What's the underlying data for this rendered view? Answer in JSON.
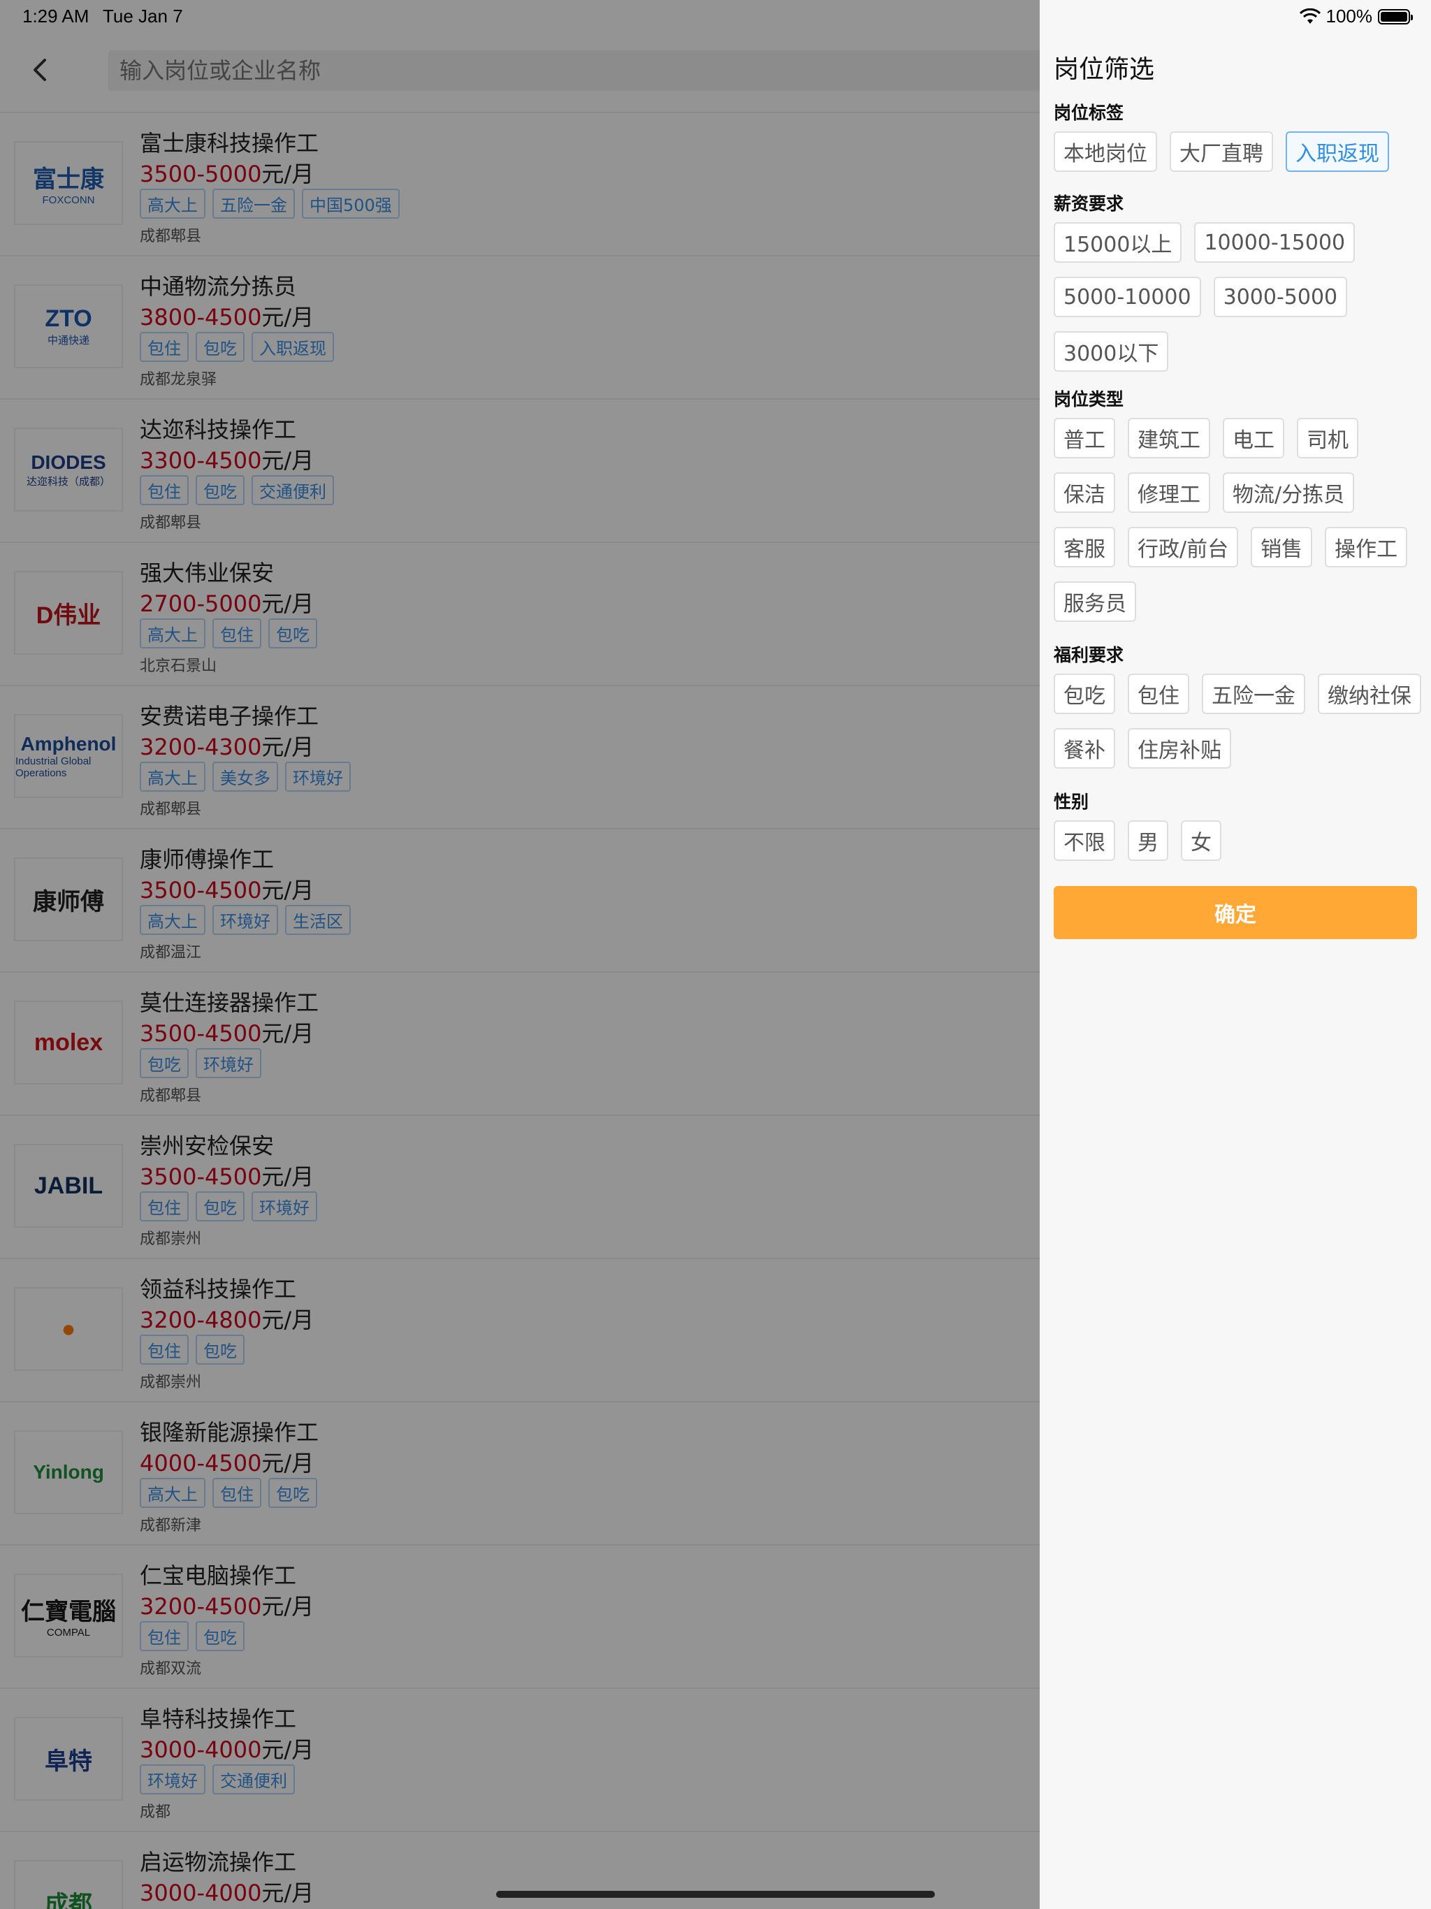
{
  "status_bar": {
    "time": "1:29 AM",
    "date": "Tue Jan 7",
    "battery": "100%"
  },
  "search": {
    "placeholder": "输入岗位或企业名称"
  },
  "jobs": [
    {
      "title": "富士康科技操作工",
      "salary_low": "3500",
      "salary_high": "5000",
      "unit": "元/月",
      "tags": [
        "高大上",
        "五险一金",
        "中国500强"
      ],
      "location": "成都郫县",
      "logo_text": "富士康",
      "logo_sub": "FOXCONN",
      "logo_color": "#1f5fb0"
    },
    {
      "title": "中通物流分拣员",
      "salary_low": "3800",
      "salary_high": "4500",
      "unit": "元/月",
      "tags": [
        "包住",
        "包吃",
        "入职返现"
      ],
      "location": "成都龙泉驿",
      "logo_text": "ZTO",
      "logo_sub": "中通快递",
      "logo_color": "#1c55b0"
    },
    {
      "title": "达迩科技操作工",
      "salary_low": "3300",
      "salary_high": "4500",
      "unit": "元/月",
      "tags": [
        "包住",
        "包吃",
        "交通便利"
      ],
      "location": "成都郫县",
      "logo_text": "DIODES",
      "logo_sub": "达迩科技（成都）",
      "logo_color": "#1d3e8a"
    },
    {
      "title": "强大伟业保安",
      "salary_low": "2700",
      "salary_high": "5000",
      "unit": "元/月",
      "tags": [
        "高大上",
        "包住",
        "包吃"
      ],
      "location": "北京石景山",
      "logo_text": "D伟业",
      "logo_sub": "",
      "logo_color": "#c0141a"
    },
    {
      "title": "安费诺电子操作工",
      "salary_low": "3200",
      "salary_high": "4300",
      "unit": "元/月",
      "tags": [
        "高大上",
        "美女多",
        "环境好"
      ],
      "location": "成都郫县",
      "logo_text": "Amphenol",
      "logo_sub": "Industrial Global Operations",
      "logo_color": "#1a4d9c"
    },
    {
      "title": "康师傅操作工",
      "salary_low": "3500",
      "salary_high": "4500",
      "unit": "元/月",
      "tags": [
        "高大上",
        "环境好",
        "生活区"
      ],
      "location": "成都温江",
      "logo_text": "康师傅",
      "logo_sub": "",
      "logo_color": "#222222"
    },
    {
      "title": "莫仕连接器操作工",
      "salary_low": "3500",
      "salary_high": "4500",
      "unit": "元/月",
      "tags": [
        "包吃",
        "环境好"
      ],
      "location": "成都郫县",
      "logo_text": "molex",
      "logo_sub": "",
      "logo_color": "#d0141a"
    },
    {
      "title": "崇州安检保安",
      "salary_low": "3500",
      "salary_high": "4500",
      "unit": "元/月",
      "tags": [
        "包住",
        "包吃",
        "环境好"
      ],
      "location": "成都崇州",
      "logo_text": "JABIL",
      "logo_sub": "",
      "logo_color": "#12315e"
    },
    {
      "title": "领益科技操作工",
      "salary_low": "3200",
      "salary_high": "4800",
      "unit": "元/月",
      "tags": [
        "包住",
        "包吃"
      ],
      "location": "成都崇州",
      "logo_text": "●",
      "logo_sub": "",
      "logo_color": "#ff7a00"
    },
    {
      "title": "银隆新能源操作工",
      "salary_low": "4000",
      "salary_high": "4500",
      "unit": "元/月",
      "tags": [
        "高大上",
        "包住",
        "包吃"
      ],
      "location": "成都新津",
      "logo_text": "Yinlong",
      "logo_sub": "",
      "logo_color": "#1c8f3a"
    },
    {
      "title": "仁宝电脑操作工",
      "salary_low": "3200",
      "salary_high": "4500",
      "unit": "元/月",
      "tags": [
        "包住",
        "包吃"
      ],
      "location": "成都双流",
      "logo_text": "仁寶電腦",
      "logo_sub": "COMPAL",
      "logo_color": "#1a1a1a"
    },
    {
      "title": "阜特科技操作工",
      "salary_low": "3000",
      "salary_high": "4000",
      "unit": "元/月",
      "tags": [
        "环境好",
        "交通便利"
      ],
      "location": "成都",
      "logo_text": "阜特",
      "logo_sub": "",
      "logo_color": "#1a3f90"
    },
    {
      "title": "启运物流操作工",
      "salary_low": "3000",
      "salary_high": "4000",
      "unit": "元/月",
      "tags": [],
      "location": "",
      "logo_text": "成都",
      "logo_sub": "",
      "logo_color": "#1c8f3a"
    }
  ],
  "filter": {
    "title": "岗位筛选",
    "sections": [
      {
        "label": "岗位标签",
        "options": [
          "本地岗位",
          "大厂直聘",
          "入职返现"
        ],
        "selected": [
          "入职返现"
        ]
      },
      {
        "label": "薪资要求",
        "options": [
          "15000以上",
          "10000-15000",
          "5000-10000",
          "3000-5000",
          "3000以下"
        ],
        "selected": []
      },
      {
        "label": "岗位类型",
        "options": [
          "普工",
          "建筑工",
          "电工",
          "司机",
          "保洁",
          "修理工",
          "物流/分拣员",
          "客服",
          "行政/前台",
          "销售",
          "操作工",
          "服务员"
        ],
        "selected": []
      },
      {
        "label": "福利要求",
        "options": [
          "包吃",
          "包住",
          "五险一金",
          "缴纳社保",
          "餐补",
          "住房补贴"
        ],
        "selected": []
      },
      {
        "label": "性别",
        "options": [
          "不限",
          "男",
          "女"
        ],
        "selected": []
      }
    ],
    "confirm_label": "确定"
  },
  "colors": {
    "accent": "#ffa836",
    "salary": "#d0021b",
    "tag": "#3a8ee6",
    "selected_chip": "#2f8fe0"
  }
}
